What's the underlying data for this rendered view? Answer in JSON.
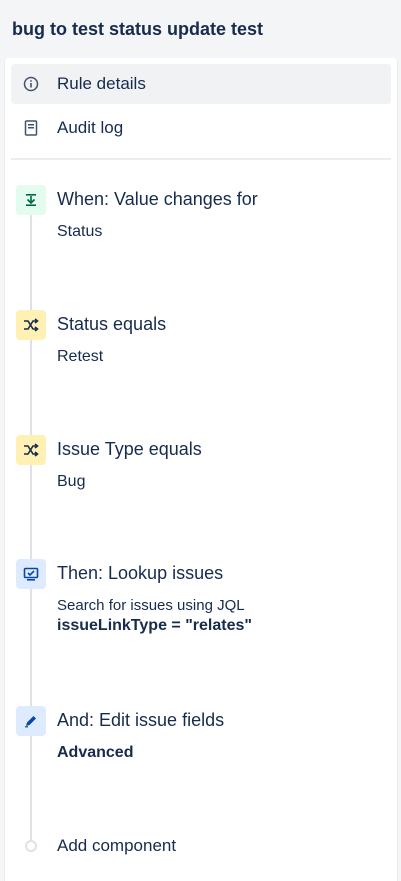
{
  "rule": {
    "title": "bug to test status update test"
  },
  "nav": [
    {
      "label": "Rule details",
      "icon": "info-icon",
      "active": true
    },
    {
      "label": "Audit log",
      "icon": "document-icon",
      "active": false
    }
  ],
  "steps": [
    {
      "title": "When: Value changes for",
      "detail": "Status",
      "icon": "trigger-icon",
      "color": "#e3fcef"
    },
    {
      "title": "Status equals",
      "detail": "Retest",
      "icon": "shuffle-icon",
      "color": "#fff0b3"
    },
    {
      "title": "Issue Type equals",
      "detail": "Bug",
      "icon": "shuffle-icon",
      "color": "#fff0b3"
    },
    {
      "title": "Then: Lookup issues",
      "detail": "Search for issues using JQL",
      "detail2": "issueLinkType = \"relates\"",
      "icon": "monitor-icon",
      "color": "#deebff"
    },
    {
      "title": "And: Edit issue fields",
      "detail": "Advanced",
      "icon": "pencil-icon",
      "color": "#deebff"
    }
  ],
  "add_component": {
    "label": "Add component"
  }
}
